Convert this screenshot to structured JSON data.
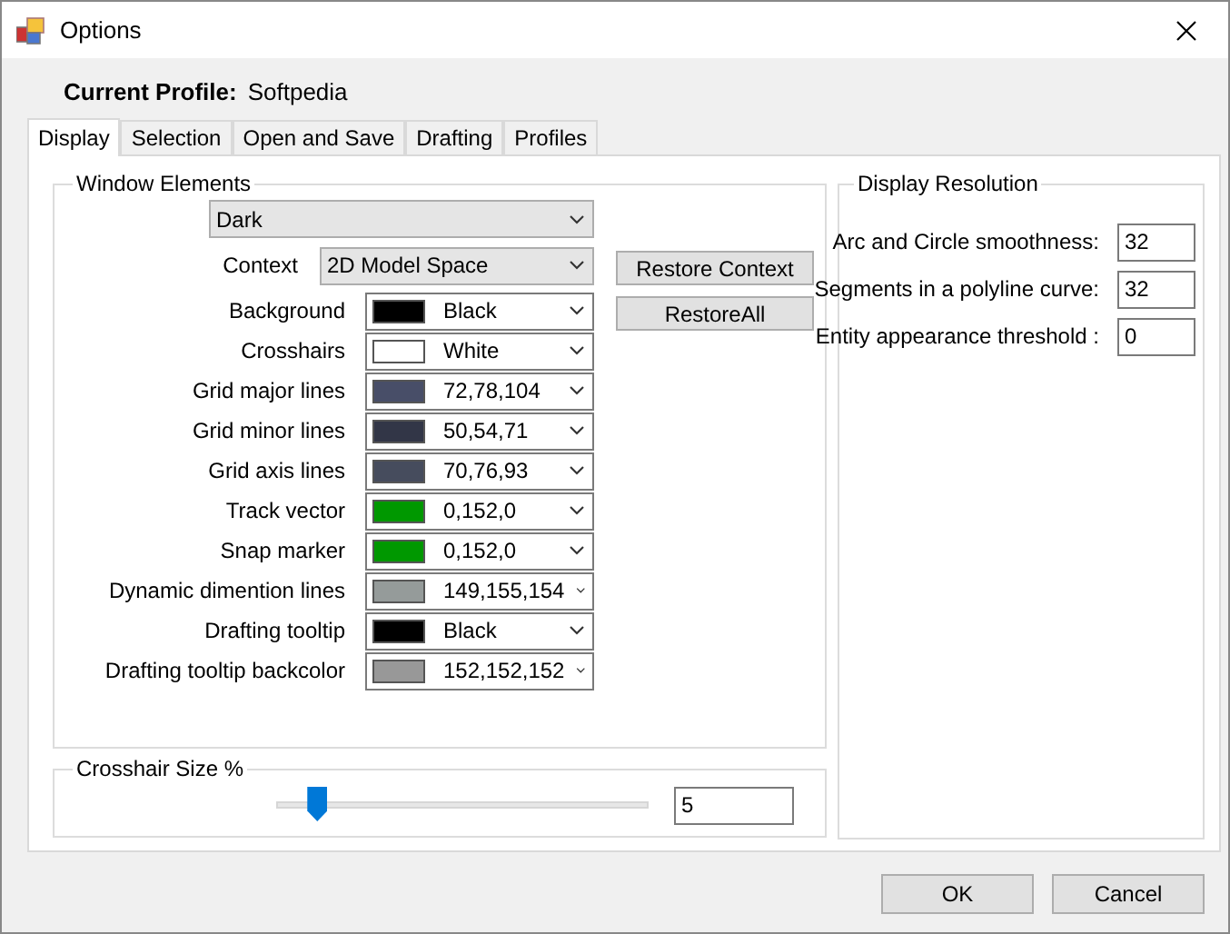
{
  "window": {
    "title": "Options"
  },
  "current_profile": {
    "label": "Current Profile:",
    "value": "Softpedia"
  },
  "tabs": [
    {
      "label": "Display",
      "selected": true
    },
    {
      "label": "Selection",
      "selected": false
    },
    {
      "label": "Open and Save",
      "selected": false
    },
    {
      "label": "Drafting",
      "selected": false
    },
    {
      "label": "Profiles",
      "selected": false
    }
  ],
  "window_elements": {
    "title": "Window Elements",
    "theme": {
      "value": "Dark"
    },
    "context": {
      "label": "Context",
      "value": "2D Model Space"
    },
    "colors": [
      {
        "label": "Background",
        "value": "Black",
        "color": "#000000"
      },
      {
        "label": "Crosshairs",
        "value": "White",
        "color": "#ffffff"
      },
      {
        "label": "Grid major lines",
        "value": "72,78,104",
        "color": "#484e68"
      },
      {
        "label": "Grid minor lines",
        "value": "50,54,71",
        "color": "#323647"
      },
      {
        "label": "Grid axis lines",
        "value": "70,76,93",
        "color": "#464c5d"
      },
      {
        "label": "Track vector",
        "value": "0,152,0",
        "color": "#009800"
      },
      {
        "label": "Snap marker",
        "value": "0,152,0",
        "color": "#009800"
      },
      {
        "label": "Dynamic dimention lines",
        "value": "149,155,154",
        "color": "#959b9a"
      },
      {
        "label": "Drafting tooltip",
        "value": "Black",
        "color": "#000000"
      },
      {
        "label": "Drafting tooltip backcolor",
        "value": "152,152,152",
        "color": "#989898"
      }
    ],
    "buttons": [
      "Restore Context",
      "RestoreAll"
    ]
  },
  "crosshair_size": {
    "title": "Crosshair Size %",
    "level": 0.05,
    "value": "5"
  },
  "display_resolution": {
    "title": "Display Resolution",
    "fields": [
      {
        "label": "Arc and Circle smoothness:",
        "value": "32"
      },
      {
        "label": "Segments in a polyline curve:",
        "value": "32"
      },
      {
        "label": "Entity appearance threshold :",
        "value": "0"
      }
    ]
  },
  "buttons": [
    "OK",
    "Cancel"
  ]
}
